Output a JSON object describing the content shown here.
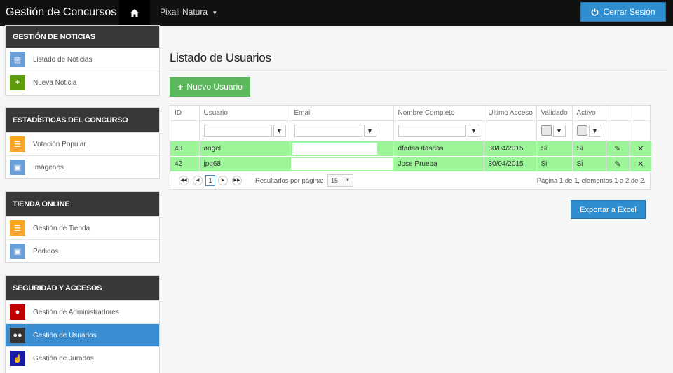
{
  "navbar": {
    "brand": "Gestión de Concursos",
    "home_icon": "home-icon",
    "account": "Pixall Natura",
    "logout_label": "Cerrar Sesión",
    "logout_icon": "power-icon"
  },
  "sidebar": {
    "sections": [
      {
        "title": "GESTIÓN DE NOTICIAS",
        "items": [
          {
            "label": "Listado de Noticias",
            "icon": "document-icon",
            "color": "#6a9fd8"
          },
          {
            "label": "Nueva Noticia",
            "icon": "plus-icon",
            "color": "#5d9c0a"
          }
        ]
      },
      {
        "title": "ESTADÍSTICAS DEL CONCURSO",
        "items": [
          {
            "label": "Votación Popular",
            "icon": "list-icon",
            "color": "#f5a623"
          },
          {
            "label": "Imágenes",
            "icon": "image-icon",
            "color": "#6a9fd8"
          }
        ]
      },
      {
        "title": "TIENDA ONLINE",
        "items": [
          {
            "label": "Gestión de Tienda",
            "icon": "list-icon",
            "color": "#f5a623"
          },
          {
            "label": "Pedidos",
            "icon": "image-icon",
            "color": "#6a9fd8"
          }
        ]
      },
      {
        "title": "SEGURIDAD Y ACCESOS",
        "items": [
          {
            "label": "Gestión de Administradores",
            "icon": "admin-user-icon",
            "color": "#c00000"
          },
          {
            "label": "Gestión de Usuarios",
            "icon": "users-icon",
            "color": "#333333",
            "active": true
          },
          {
            "label": "Gestión de Jurados",
            "icon": "thumbs-up-icon",
            "color": "#1a1aa8"
          }
        ]
      }
    ]
  },
  "main": {
    "title": "Listado de Usuarios",
    "new_user_label": "Nuevo Usuario",
    "export_label": "Exportar a Excel",
    "grid": {
      "columns": [
        "ID",
        "Usuario",
        "Email",
        "Nombre Completo",
        "Ultimo Acceso",
        "Validado",
        "Activo",
        "",
        ""
      ],
      "rows": [
        {
          "id": "43",
          "usuario": "angel",
          "email": "",
          "nombre": "dfadsa dasdas",
          "acceso": "30/04/2015",
          "validado": "Si",
          "activo": "Si"
        },
        {
          "id": "42",
          "usuario": "jpg68",
          "email": "",
          "nombre": "Jose Prueba",
          "acceso": "30/04/2015",
          "validado": "Si",
          "activo": "Si"
        }
      ],
      "pager": {
        "current_page": "1",
        "per_page_label": "Resultados por página:",
        "per_page_value": "15",
        "info": "Página 1 de 1, elementos 1 a 2 de 2."
      }
    }
  },
  "colors": {
    "navbar": "#111111",
    "primary": "#2e8ecf",
    "success": "#5cb85c",
    "row_highlight": "#9df59a",
    "sidebar_head": "#383838",
    "active_item": "#3a8dd1"
  }
}
